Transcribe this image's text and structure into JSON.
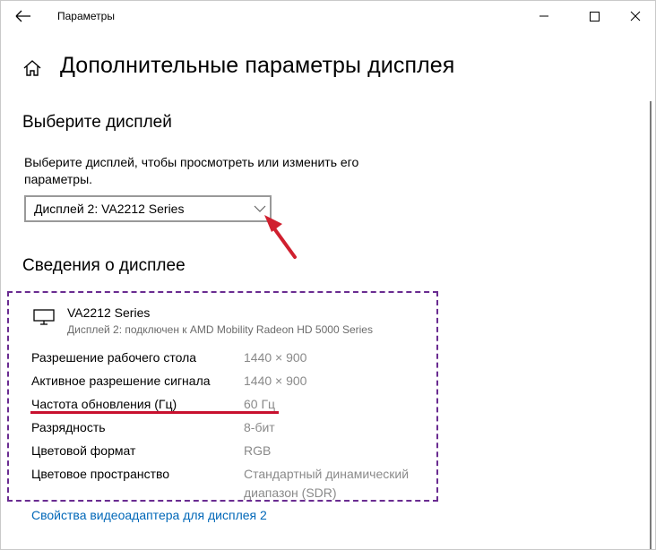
{
  "window": {
    "title": "Параметры"
  },
  "page": {
    "title": "Дополнительные параметры дисплея"
  },
  "select_section": {
    "title": "Выберите дисплей",
    "description": "Выберите дисплей, чтобы просмотреть или изменить его параметры.",
    "selected_display": "Дисплей 2: VA2212 Series"
  },
  "info_section": {
    "title": "Сведения о дисплее",
    "monitor_name": "VA2212 Series",
    "monitor_subtitle": "Дисплей 2: подключен к AMD Mobility Radeon HD 5000 Series",
    "rows": [
      {
        "label": "Разрешение рабочего стола",
        "value": "1440 × 900"
      },
      {
        "label": "Активное разрешение сигнала",
        "value": "1440 × 900"
      },
      {
        "label": "Частота обновления (Гц)",
        "value": "60 Гц"
      },
      {
        "label": "Разрядность",
        "value": "8-бит"
      },
      {
        "label": "Цветовой формат",
        "value": "RGB"
      },
      {
        "label": "Цветовое пространство",
        "value": "Стандартный динамический диапазон (SDR)"
      }
    ],
    "adapter_link": "Свойства видеоадаптера для дисплея 2"
  },
  "colors": {
    "accent_link": "#0067b8",
    "annotation_red": "#c8102e",
    "annotation_box": "#6a2c91"
  }
}
